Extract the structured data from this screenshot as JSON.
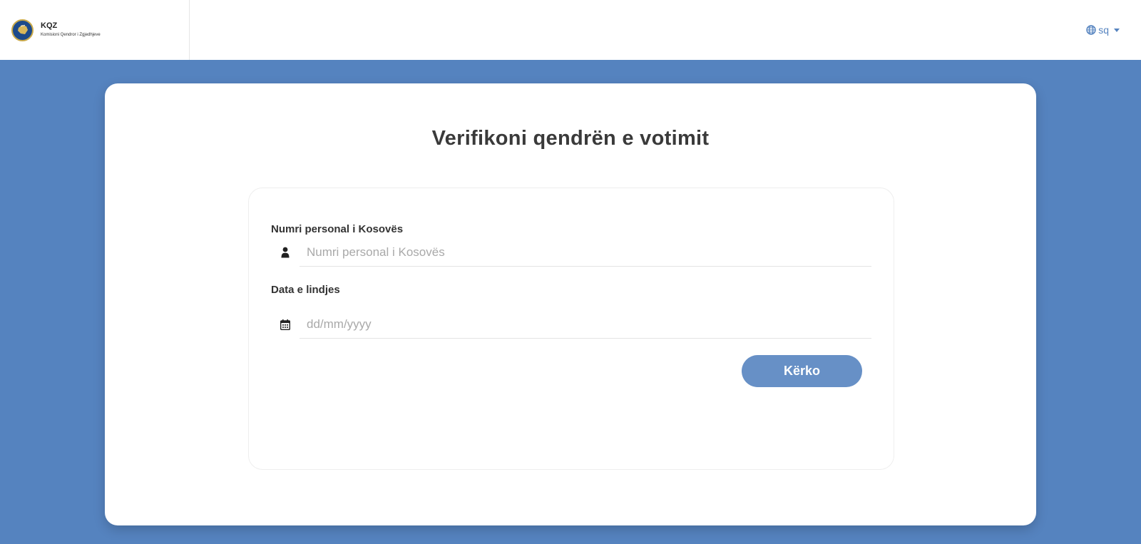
{
  "header": {
    "brand_title": "KQZ",
    "brand_subtitle": "Komisioni Qendror i Zgjedhjeve",
    "language": "sq"
  },
  "main": {
    "title": "Verifikoni qendrën e votimit",
    "personal_number": {
      "label": "Numri personal i Kosovës",
      "placeholder": "Numri personal i Kosovës",
      "value": ""
    },
    "birth_date": {
      "label": "Data e lindjes",
      "placeholder": "dd/mm/yyyy",
      "value": ""
    },
    "search_label": "Kërko"
  },
  "colors": {
    "background": "#5583bf",
    "button": "#6790c6",
    "accent": "#5583bf"
  }
}
